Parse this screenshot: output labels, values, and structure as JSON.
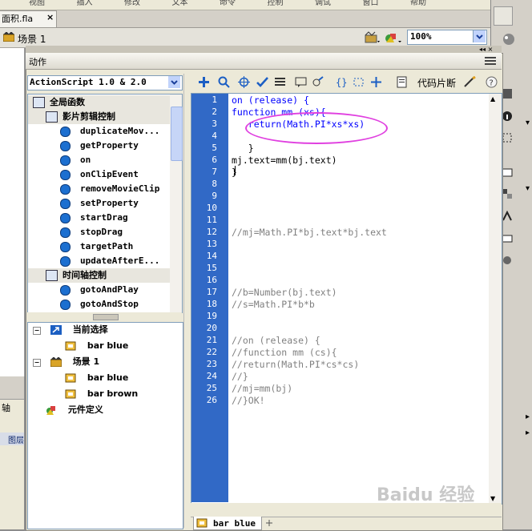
{
  "document_tab": {
    "label": "面积.fla",
    "close": "×"
  },
  "menu_fragments": [
    "视图",
    "插入",
    "修改",
    "文本",
    "命令",
    "控制",
    "调试",
    "窗口",
    "帮助"
  ],
  "scene_bar": {
    "scene": "场景 1",
    "zoom": "100%"
  },
  "left_strip": {
    "axis_label": "轴",
    "layer_label": "图层"
  },
  "actions_panel": {
    "title": "动作",
    "language_select": "ActionScript 1.0 & 2.0",
    "toolbox": {
      "categories": [
        {
          "label": "全局函数",
          "level": 0
        },
        {
          "label": "影片剪辑控制",
          "level": 1
        },
        {
          "label": "时间轴控制",
          "level": 1
        }
      ],
      "mc_items": [
        "duplicateMov...",
        "getProperty",
        "on",
        "onClipEvent",
        "removeMovieClip",
        "setProperty",
        "startDrag",
        "stopDrag",
        "targetPath",
        "updateAfterE..."
      ],
      "timeline_items": [
        "gotoAndPlay",
        "gotoAndStop"
      ]
    },
    "script_nav": {
      "current_selection": "当前选择",
      "current_item": "bar blue",
      "scene": "场景 1",
      "scene_items": [
        "bar blue",
        "bar brown"
      ],
      "symbol_definitions": "元件定义"
    },
    "toolbar": {
      "snippets": "代码片断"
    },
    "code_lines": [
      "on (release) {",
      "function mm (xs){",
      "   return(Math.PI*xs*xs)",
      "",
      "   }",
      "mj.text=mm(bj.text)",
      "}",
      "",
      "",
      "",
      "",
      "//mj=Math.PI*bj.text*bj.text",
      "",
      "",
      "",
      "",
      "//b=Number(bj.text)",
      "//s=Math.PI*b*b",
      "",
      "",
      "//on (release) {",
      "//function mm (cs){",
      "//return(Math.PI*cs*cs)",
      "//}",
      "//mj=mm(bj)",
      "//}OK!"
    ],
    "line_numbers": [
      "1",
      "2",
      "3",
      "4",
      "5",
      "6",
      "7",
      "8",
      "9",
      "10",
      "11",
      "12",
      "13",
      "14",
      "15",
      "16",
      "17",
      "18",
      "19",
      "20",
      "21",
      "22",
      "23",
      "24",
      "25",
      "26"
    ],
    "bottom_tab": "bar blue"
  },
  "watermark": "Baidu 经验",
  "colors": {
    "gutter": "#3169c6",
    "keyword": "#0000ff",
    "comment": "#808080",
    "highlight_ellipse": "#e040e0"
  }
}
